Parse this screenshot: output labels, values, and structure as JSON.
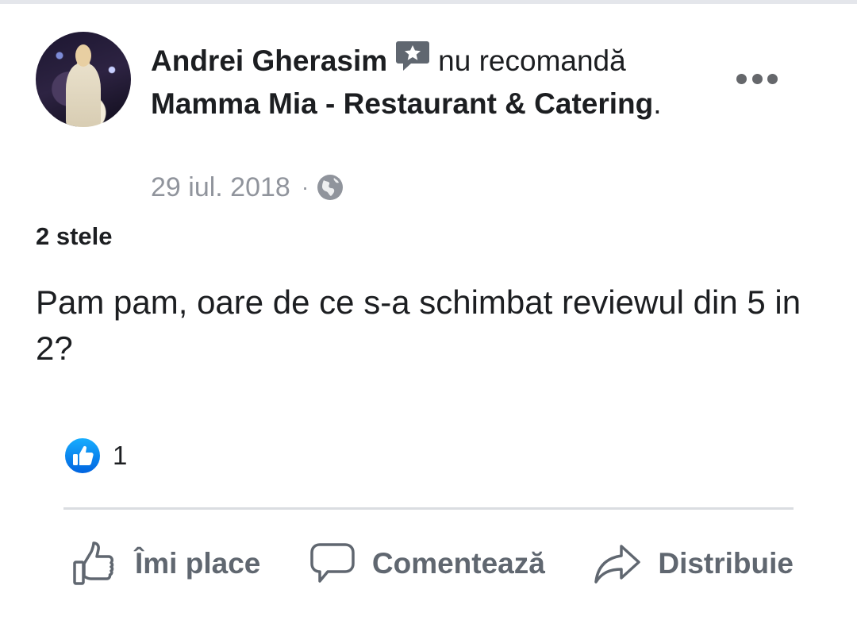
{
  "post": {
    "author": "Andrei Gherasim",
    "action": "nu recomandă",
    "page_name": "Mamma Mia - Restaurant & Catering",
    "period": ".",
    "date": "29 iul. 2018",
    "separator": "·",
    "privacy_icon": "globe-icon",
    "rating_text": "2 stele",
    "text": "Pam pam, oare de ce s-a schimbat reviewul din 5 in 2?"
  },
  "reactions": {
    "icon": "like-reaction-icon",
    "count": "1"
  },
  "actions": {
    "like_label": "Îmi place",
    "comment_label": "Comentează",
    "share_label": "Distribuie"
  },
  "colors": {
    "text_primary": "#1c1e21",
    "text_secondary": "#606770",
    "meta_gray": "#90949c",
    "like_blue": "#1877f2",
    "divider": "#dadde1"
  }
}
